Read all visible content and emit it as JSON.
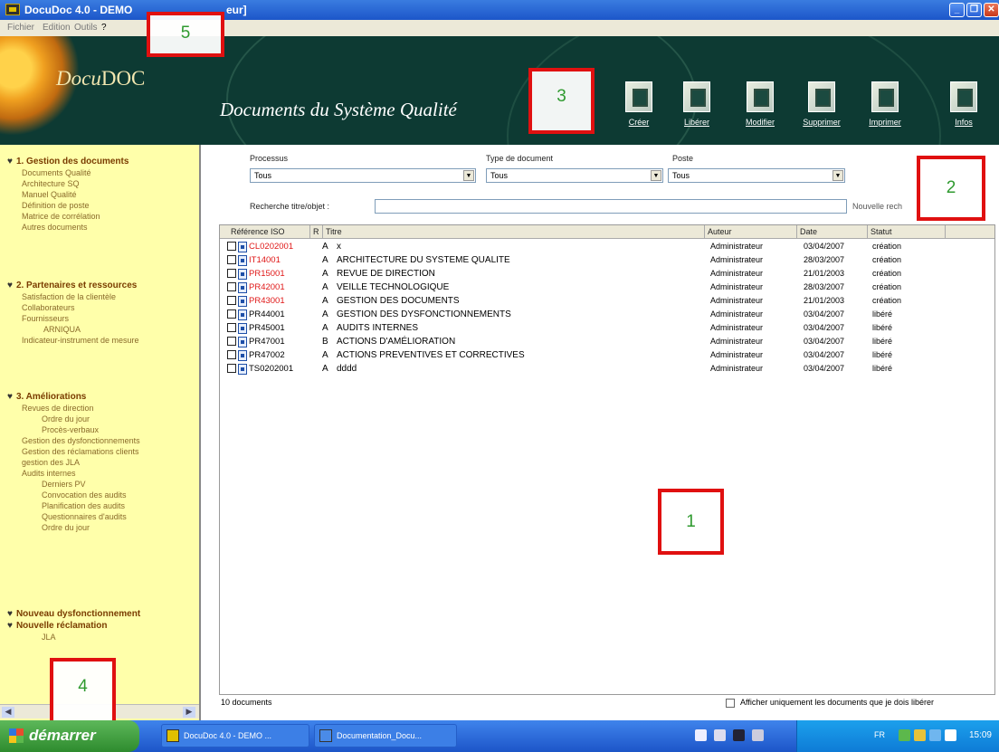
{
  "window": {
    "title": "DocuDoc 4.0 - DEMO",
    "title_suffix": "eur]"
  },
  "menu": [
    "Fichier",
    "Edition",
    "Outils",
    "?"
  ],
  "header": {
    "logo_prefix": "Docu",
    "logo_suffix": "DOC",
    "banner_title": "Documents du Système Qualité",
    "tools": [
      {
        "label": "Créer",
        "icon": "create-document-icon"
      },
      {
        "label": "Libérer",
        "icon": "release-document-icon"
      },
      {
        "label": "Modifier",
        "icon": "edit-document-icon"
      },
      {
        "label": "Supprimer",
        "icon": "delete-document-icon"
      },
      {
        "label": "Imprimer",
        "icon": "printer-icon"
      },
      {
        "label": "Infos",
        "icon": "info-icon"
      }
    ]
  },
  "sidebar": {
    "sections": [
      {
        "title": "1. Gestion des documents",
        "items": [
          "Documents Qualité",
          "Architecture SQ",
          "Manuel Qualité",
          "Définition de poste",
          "Matrice de corrélation",
          "Autres documents"
        ]
      },
      {
        "title": "2. Partenaires et ressources",
        "items": [
          "Satisfaction de la clientèle",
          "Collaborateurs",
          "Fournisseurs",
          "ARNIQUA",
          "Indicateur-instrument de mesure"
        ]
      },
      {
        "title": "3. Améliorations",
        "items": [
          "Revues de direction",
          "Ordre du jour",
          "Procès-verbaux",
          "Gestion des dysfonctionnements",
          "Gestion des réclamations clients",
          "gestion des JLA",
          "Audits internes",
          "Derniers PV",
          "Convocation des audits",
          "Planification des audits",
          "Questionnaires d'audits",
          "Ordre du jour"
        ]
      },
      {
        "title": "Nouveau dysfonctionnement",
        "items": []
      },
      {
        "title": "Nouvelle réclamation",
        "items": [
          "JLA"
        ]
      }
    ]
  },
  "filters": {
    "processus_label": "Processus",
    "processus_value": "Tous",
    "type_label": "Type de document",
    "type_value": "Tous",
    "poste_label": "Poste",
    "poste_value": "Tous",
    "search_label": "Recherche titre/objet :",
    "search_value": "",
    "new_search": "Nouvelle rech"
  },
  "table": {
    "headers": [
      "Référence ISO",
      "R",
      "Titre",
      "Auteur",
      "Date",
      "Statut"
    ],
    "rows": [
      {
        "ref": "CL0202001",
        "rev": "A",
        "title": "x",
        "author": "Administrateur",
        "date": "03/04/2007",
        "status": "création",
        "color": "#e01818"
      },
      {
        "ref": "IT14001",
        "rev": "A",
        "title": "ARCHITECTURE DU SYSTEME QUALITE",
        "author": "Administrateur",
        "date": "28/03/2007",
        "status": "création",
        "color": "#e01818"
      },
      {
        "ref": "PR15001",
        "rev": "A",
        "title": "REVUE DE DIRECTION",
        "author": "Administrateur",
        "date": "21/01/2003",
        "status": "création",
        "color": "#e01818"
      },
      {
        "ref": "PR42001",
        "rev": "A",
        "title": "VEILLE TECHNOLOGIQUE",
        "author": "Administrateur",
        "date": "28/03/2007",
        "status": "création",
        "color": "#e01818"
      },
      {
        "ref": "PR43001",
        "rev": "A",
        "title": "GESTION DES DOCUMENTS",
        "author": "Administrateur",
        "date": "21/01/2003",
        "status": "création",
        "color": "#e01818"
      },
      {
        "ref": "PR44001",
        "rev": "A",
        "title": "GESTION DES DYSFONCTIONNEMENTS",
        "author": "Administrateur",
        "date": "03/04/2007",
        "status": "libéré",
        "color": "#000000"
      },
      {
        "ref": "PR45001",
        "rev": "A",
        "title": "AUDITS INTERNES",
        "author": "Administrateur",
        "date": "03/04/2007",
        "status": "libéré",
        "color": "#000000"
      },
      {
        "ref": "PR47001",
        "rev": "B",
        "title": "ACTIONS D'AMÉLIORATION",
        "author": "Administrateur",
        "date": "03/04/2007",
        "status": "libéré",
        "color": "#000000"
      },
      {
        "ref": "PR47002",
        "rev": "A",
        "title": "ACTIONS PREVENTIVES ET CORRECTIVES",
        "author": "Administrateur",
        "date": "03/04/2007",
        "status": "libéré",
        "color": "#000000"
      },
      {
        "ref": "TS0202001",
        "rev": "A",
        "title": "dddd",
        "author": "Administrateur",
        "date": "03/04/2007",
        "status": "libéré",
        "color": "#000000"
      }
    ]
  },
  "footer": {
    "count": "10 documents",
    "filter_label": "Afficher uniquement les documents que je dois libérer"
  },
  "annotations": [
    "1",
    "2",
    "3",
    "4",
    "5"
  ],
  "taskbar": {
    "start": "démarrer",
    "tasks": [
      "DocuDoc 4.0 - DEMO ...",
      "Documentation_Docu..."
    ],
    "lang": "FR",
    "clock": "15:09"
  }
}
